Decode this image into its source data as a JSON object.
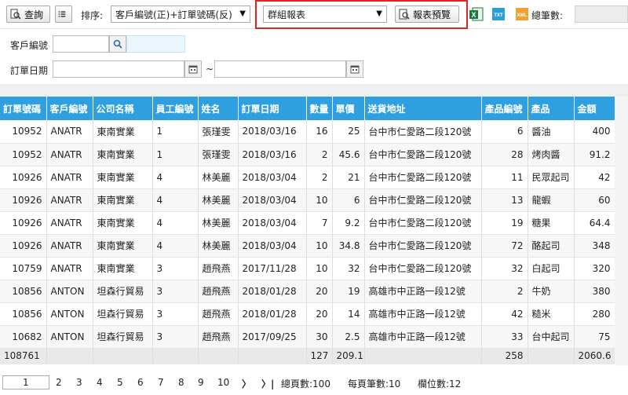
{
  "toolbar": {
    "query_label": "查詢",
    "sort_label": "排序:",
    "sort_value": "客戶編號(正)+訂單號碼(反)",
    "report_value": "群組報表",
    "preview_label": "報表預覽",
    "excel_icon_text": "X",
    "txt_icon_text": "TXT",
    "xml_icon_text": "XML",
    "total_label": "總筆數:"
  },
  "filters": {
    "customer_label": "客戶編號",
    "customer_value": "",
    "date_label": "訂單日期",
    "date_from": "",
    "date_sep": "~",
    "date_to": ""
  },
  "grid": {
    "columns": [
      "訂單號碼",
      "客戶編號",
      "公司名稱",
      "員工編號",
      "姓名",
      "訂單日期",
      "數量",
      "單價",
      "送貨地址",
      "產品編號",
      "產品",
      "金額"
    ],
    "rows": [
      [
        "10952",
        "ANATR",
        "東南實業",
        "1",
        "張瑾雯",
        "2018/03/16",
        "16",
        "25",
        "台中市仁愛路二段120號",
        "6",
        "醬油",
        "400"
      ],
      [
        "10952",
        "ANATR",
        "東南實業",
        "1",
        "張瑾雯",
        "2018/03/16",
        "2",
        "45.6",
        "台中市仁愛路二段120號",
        "28",
        "烤肉醬",
        "91.2"
      ],
      [
        "10926",
        "ANATR",
        "東南實業",
        "4",
        "林美麗",
        "2018/03/04",
        "2",
        "21",
        "台中市仁愛路二段120號",
        "11",
        "民眾起司",
        "42"
      ],
      [
        "10926",
        "ANATR",
        "東南實業",
        "4",
        "林美麗",
        "2018/03/04",
        "10",
        "6",
        "台中市仁愛路二段120號",
        "13",
        "龍蝦",
        "60"
      ],
      [
        "10926",
        "ANATR",
        "東南實業",
        "4",
        "林美麗",
        "2018/03/04",
        "7",
        "9.2",
        "台中市仁愛路二段120號",
        "19",
        "糖果",
        "64.4"
      ],
      [
        "10926",
        "ANATR",
        "東南實業",
        "4",
        "林美麗",
        "2018/03/04",
        "10",
        "34.8",
        "台中市仁愛路二段120號",
        "72",
        "酪起司",
        "348"
      ],
      [
        "10759",
        "ANATR",
        "東南實業",
        "3",
        "趙飛燕",
        "2017/11/28",
        "10",
        "32",
        "台中市仁愛路二段120號",
        "32",
        "白起司",
        "320"
      ],
      [
        "10856",
        "ANTON",
        "坦森行貿易",
        "3",
        "趙飛燕",
        "2018/01/28",
        "20",
        "19",
        "高雄市中正路一段12號",
        "2",
        "牛奶",
        "380"
      ],
      [
        "10856",
        "ANTON",
        "坦森行貿易",
        "3",
        "趙飛燕",
        "2018/01/28",
        "20",
        "14",
        "高雄市中正路一段12號",
        "42",
        "糙米",
        "280"
      ],
      [
        "10682",
        "ANTON",
        "坦森行貿易",
        "3",
        "趙飛燕",
        "2017/09/25",
        "30",
        "2.5",
        "高雄市中正路一段12號",
        "33",
        "台中起司",
        "75"
      ]
    ],
    "summary": [
      "108761",
      "",
      "",
      "",
      "",
      "",
      "127",
      "209.1",
      "",
      "258",
      "",
      "2060.6"
    ]
  },
  "pager": {
    "current": "1",
    "pages": [
      "2",
      "3",
      "4",
      "5",
      "6",
      "7",
      "8",
      "9",
      "10"
    ],
    "next": "〉",
    "last": "〉|",
    "total_pages": "總頁數:100",
    "page_size": "每頁筆數:10",
    "column_count": "欄位數:12"
  },
  "colors": {
    "header_blue": "#2ea0e0",
    "highlight_red": "#e02424",
    "excel_green": "#1d7a3f",
    "txt_blue": "#2a9fd8",
    "xml_orange": "#f0a22e"
  }
}
